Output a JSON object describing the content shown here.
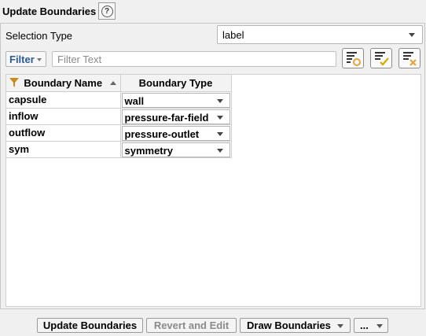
{
  "header": {
    "title": "Update Boundaries",
    "help_glyph": "?"
  },
  "selection": {
    "label": "Selection Type",
    "value": "label"
  },
  "filter": {
    "button_label": "Filter",
    "placeholder": "Filter Text",
    "value": ""
  },
  "table": {
    "columns": [
      "Boundary Name",
      "Boundary Type"
    ],
    "rows": [
      {
        "name": "capsule",
        "type": "wall"
      },
      {
        "name": "inflow",
        "type": "pressure-far-field"
      },
      {
        "name": "outflow",
        "type": "pressure-outlet"
      },
      {
        "name": "sym",
        "type": "symmetry"
      }
    ]
  },
  "buttons": {
    "update": "Update Boundaries",
    "revert": "Revert and Edit",
    "draw": "Draw Boundaries",
    "more": "..."
  },
  "colors": {
    "accent": "#2a5a9a",
    "icon_orange": "#e8a33a",
    "check_yellow": "#d8a800"
  }
}
